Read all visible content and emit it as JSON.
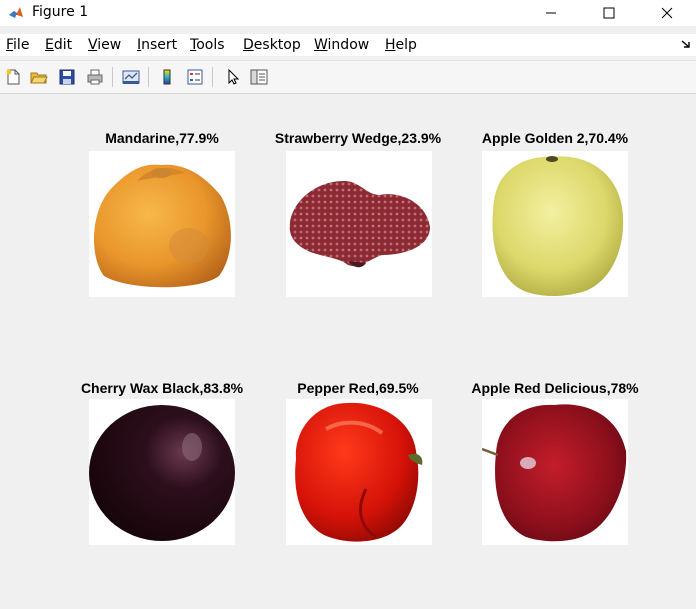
{
  "window": {
    "title": "Figure 1",
    "icon": "matlab-logo-icon"
  },
  "menu": [
    {
      "label": "File",
      "key": "F",
      "rest": "ile"
    },
    {
      "label": "Edit",
      "key": "E",
      "rest": "dit"
    },
    {
      "label": "View",
      "key": "V",
      "rest": "iew"
    },
    {
      "label": "Insert",
      "key": "I",
      "rest": "nsert"
    },
    {
      "label": "Tools",
      "key": "T",
      "rest": "ools"
    },
    {
      "label": "Desktop",
      "key": "D",
      "rest": "esktop"
    },
    {
      "label": "Window",
      "key": "W",
      "rest": "indow"
    },
    {
      "label": "Help",
      "key": "H",
      "rest": "elp"
    }
  ],
  "toolbar": [
    "new-figure-icon",
    "open-file-icon",
    "save-icon",
    "print-icon",
    "link-plot-icon",
    "insert-colorbar-icon",
    "insert-legend-icon",
    "edit-plot-icon",
    "property-inspector-icon"
  ],
  "figure": {
    "panels": [
      {
        "caption": "Mandarine,77.9%",
        "fruit": "mandarine-image"
      },
      {
        "caption": "Strawberry Wedge,23.9%",
        "fruit": "strawberry-wedge-image"
      },
      {
        "caption": "Apple Golden 2,70.4%",
        "fruit": "apple-golden-image"
      },
      {
        "caption": "Cherry Wax Black,83.8%",
        "fruit": "cherry-wax-black-image"
      },
      {
        "caption": "Pepper Red,69.5%",
        "fruit": "pepper-red-image"
      },
      {
        "caption": "Apple Red Delicious,78%",
        "fruit": "apple-red-delicious-image"
      }
    ]
  },
  "colors": {
    "figure_background": "#f0f0f0",
    "panel_background": "#ffffff"
  }
}
